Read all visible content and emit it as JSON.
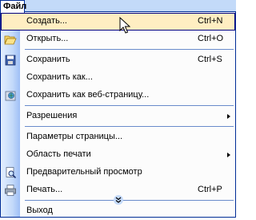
{
  "menubar": {
    "menu_title": "Файл"
  },
  "menu": {
    "items": [
      {
        "label": "Создать...",
        "shortcut": "Ctrl+N",
        "icon": "new-document-icon",
        "highlighted": true
      },
      {
        "label": "Открыть...",
        "shortcut": "Ctrl+O",
        "icon": "open-folder-icon"
      },
      {
        "label": "Сохранить",
        "shortcut": "Ctrl+S",
        "icon": "save-disk-icon"
      },
      {
        "label": "Сохранить как...",
        "shortcut": ""
      },
      {
        "label": "Сохранить как веб-страницу...",
        "shortcut": "",
        "icon": "save-web-page-icon"
      },
      {
        "label": "Разрешения",
        "submenu": true
      },
      {
        "label": "Параметры страницы..."
      },
      {
        "label": "Область печати",
        "submenu": true
      },
      {
        "label": "Предварительный просмотр",
        "icon": "print-preview-icon"
      },
      {
        "label": "Печать...",
        "shortcut": "Ctrl+P",
        "icon": "printer-icon"
      },
      {
        "label": "Выход"
      }
    ]
  },
  "colors": {
    "highlight_bg": "#ffeec2",
    "highlight_border": "#000080",
    "gutter": "#c4dafa",
    "menu_border": "#002d96"
  }
}
